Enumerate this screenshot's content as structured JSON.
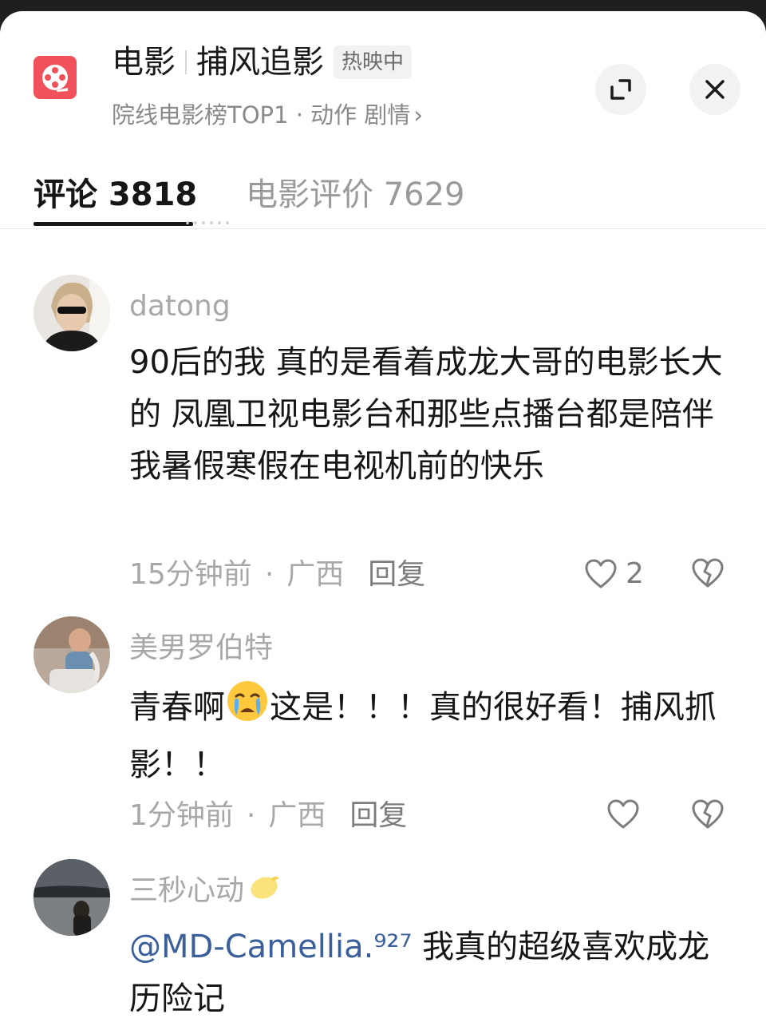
{
  "header": {
    "title_part1": "电影",
    "title_part2": "捕风追影",
    "hot_tag": "热映中",
    "subtitle": "院线电影榜TOP1 · 动作 剧情",
    "subtitle_chevron": "›"
  },
  "tabs": [
    {
      "label": "评论 3818",
      "active": true
    },
    {
      "label": "电影评价 7629",
      "active": false
    }
  ],
  "clipped_previous_text": "……",
  "comments": [
    {
      "author": "datong",
      "text": "90后的我 真的是看着成龙大哥的电影长大的 凤凰卫视电影台和那些点播台都是陪伴我暑假寒假在电视机前的快乐",
      "time": "15分钟前",
      "location": "广西",
      "reply_label": "回复",
      "likes": "2"
    },
    {
      "author": "美男罗伯特",
      "text_before_emoji": "青春啊",
      "emoji": "crying-face",
      "text_after_emoji": "这是！！！真的很好看！捕风抓影！！",
      "time": "1分钟前",
      "location": "广西",
      "reply_label": "回复",
      "likes": ""
    },
    {
      "author": "三秒心动",
      "author_emoji": "lemon",
      "mention": "@MD-Camellia.⁹²⁷",
      "text": " 我真的超级喜欢成龙历险记"
    }
  ],
  "colors": {
    "app_icon": "#f0515a",
    "mention": "#3a5f9a",
    "muted": "#a8a8a8"
  }
}
